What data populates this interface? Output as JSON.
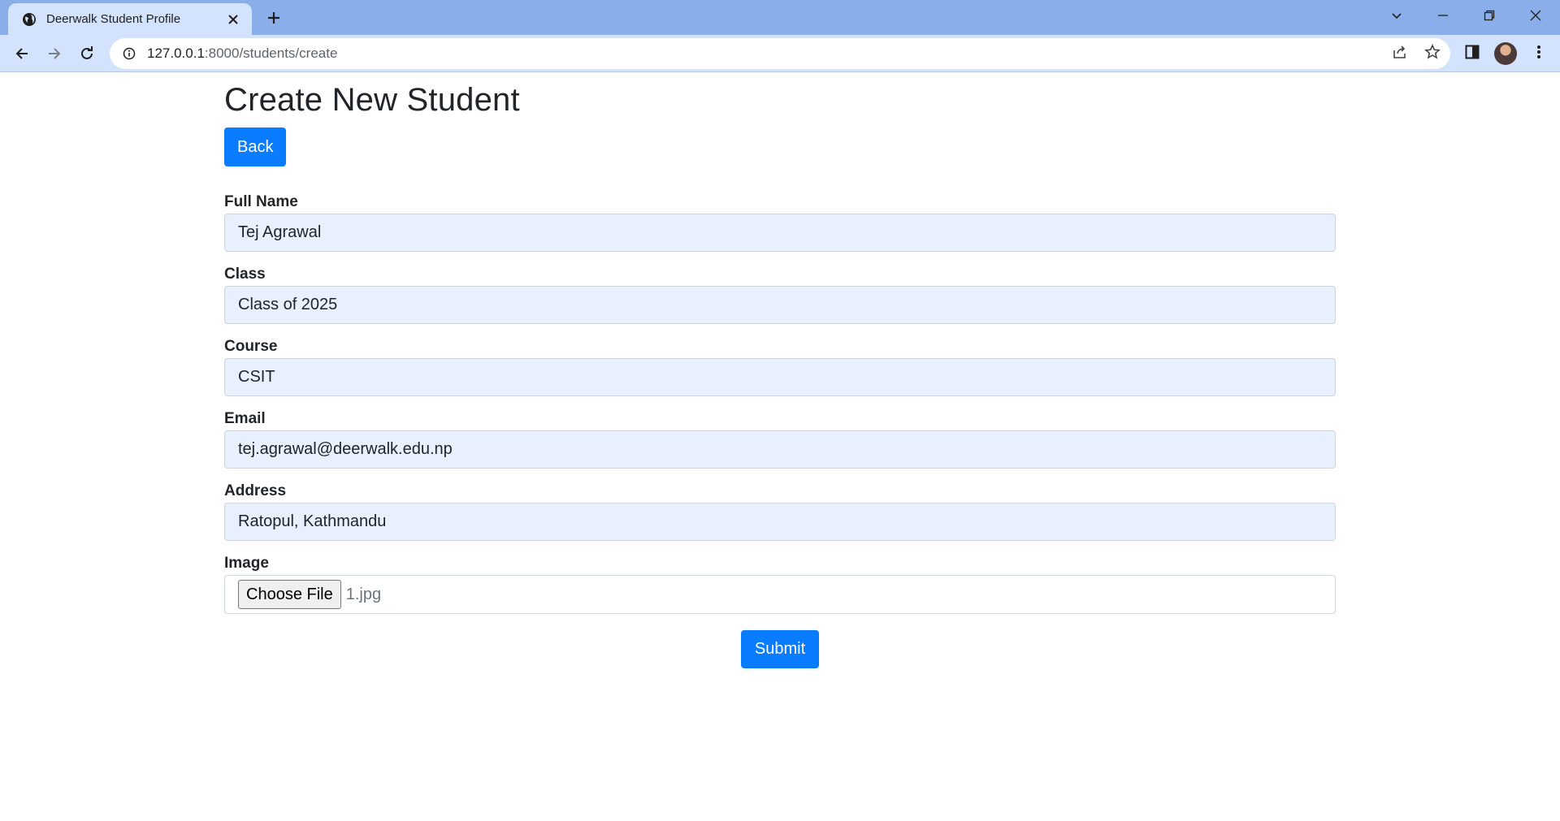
{
  "browser": {
    "tab_title": "Deerwalk Student Profile",
    "url_host": "127.0.0.1",
    "url_path": ":8000/students/create"
  },
  "page": {
    "title": "Create New Student",
    "back_label": "Back",
    "submit_label": "Submit"
  },
  "form": {
    "fields": [
      {
        "label": "Full Name",
        "value": "Tej Agrawal"
      },
      {
        "label": "Class",
        "value": "Class of 2025"
      },
      {
        "label": "Course",
        "value": "CSIT"
      },
      {
        "label": "Email",
        "value": "tej.agrawal@deerwalk.edu.np"
      },
      {
        "label": "Address",
        "value": "Ratopul, Kathmandu"
      }
    ],
    "image": {
      "label": "Image",
      "button_label": "Choose File",
      "file_name": "1.jpg"
    }
  }
}
